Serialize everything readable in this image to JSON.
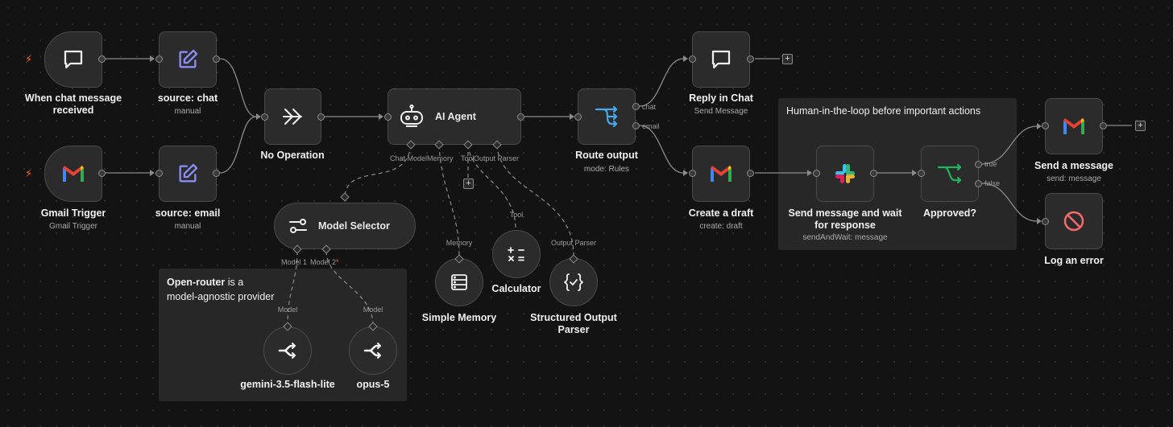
{
  "canvas": {
    "colors": {
      "background": "#131313",
      "node": "#2b2b2b",
      "edge": "#8a8a8a",
      "trigger": "#ff6a1f"
    }
  },
  "stickies": {
    "human_loop": {
      "title": "Human-in-the-loop before important actions"
    },
    "openrouter": {
      "bold": "Open-router",
      "line1_rest": " is a",
      "line2": "model-agnostic provider"
    }
  },
  "nodes": {
    "chat_trigger": {
      "label_line1": "When chat message",
      "label_line2": "received",
      "icon": "chat-bubble-icon"
    },
    "gmail_trigger": {
      "label": "Gmail Trigger",
      "sub": "Gmail Trigger",
      "icon": "gmail-icon"
    },
    "source_chat": {
      "label": "source: chat",
      "sub": "manual",
      "icon": "edit-icon"
    },
    "source_email": {
      "label": "source: email",
      "sub": "manual",
      "icon": "edit-icon"
    },
    "no_op": {
      "label": "No Operation",
      "icon": "double-arrow-icon"
    },
    "ai_agent": {
      "label": "AI Agent",
      "icon": "robot-icon",
      "ports": {
        "chat_model": "Chat Model",
        "memory": "Memory",
        "tool": "Tool",
        "output_parser": "Output Parser"
      }
    },
    "route_output": {
      "label": "Route output",
      "sub": "mode: Rules",
      "icon": "switch-icon",
      "out_chat": "chat",
      "out_email": "email"
    },
    "reply_chat": {
      "label": "Reply in Chat",
      "sub": "Send Message",
      "icon": "chat-bubble-icon"
    },
    "create_draft": {
      "label": "Create a draft",
      "sub": "create: draft",
      "icon": "gmail-icon"
    },
    "slack_send": {
      "label_line1": "Send message and wait",
      "label_line2": "for response",
      "sub": "sendAndWait: message",
      "icon": "slack-icon"
    },
    "approved": {
      "label": "Approved?",
      "icon": "if-icon",
      "out_true": "true",
      "out_false": "false"
    },
    "send_message": {
      "label": "Send a message",
      "sub": "send: message",
      "icon": "gmail-icon"
    },
    "log_error": {
      "label": "Log an error",
      "icon": "stop-icon"
    },
    "model_selector": {
      "label": "Model Selector",
      "icon": "sliders-icon",
      "port1": "Model 1",
      "port2": "Model 2",
      "required_mark": "*"
    },
    "simple_memory": {
      "label": "Simple Memory",
      "port": "Memory",
      "icon": "database-icon"
    },
    "calculator": {
      "label": "Calculator",
      "port": "Tool",
      "icon": "calculator-icon"
    },
    "output_parser": {
      "label_line1": "Structured Output",
      "label_line2": "Parser",
      "port": "Output Parser",
      "icon": "braces-icon"
    },
    "gemini": {
      "label": "gemini-3.5-flash-lite",
      "port": "Model",
      "icon": "openrouter-icon"
    },
    "opus": {
      "label": "opus-5",
      "port": "Model",
      "icon": "openrouter-icon"
    }
  },
  "controls": {
    "plus": "+",
    "trigger_bolt": "⚡"
  }
}
